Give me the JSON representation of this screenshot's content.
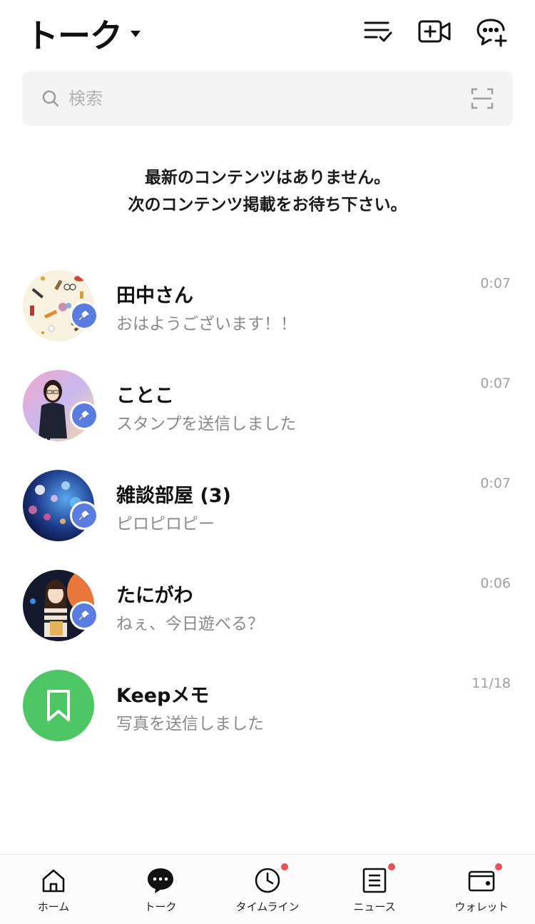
{
  "header": {
    "title": "トーク",
    "icons": [
      "edit-list-icon",
      "video-call-add-icon",
      "new-chat-icon"
    ]
  },
  "search": {
    "placeholder": "検索",
    "icons": [
      "search-icon",
      "qr-scan-icon"
    ]
  },
  "notice": {
    "line1": "最新のコンテンツはありません。",
    "line2": "次のコンテンツ掲載をお待ち下さい。"
  },
  "chats": [
    {
      "name": "田中さん",
      "message": "おはようございます！！",
      "time": "0:07",
      "pinned": true,
      "avatar": "tanaka-avatar"
    },
    {
      "name": "ことこ",
      "message": "スタンプを送信しました",
      "time": "0:07",
      "pinned": true,
      "avatar": "kotoko-avatar"
    },
    {
      "name": "雑談部屋 (3)",
      "message": "ピロピロピー",
      "time": "0:07",
      "pinned": true,
      "avatar": "group-avatar"
    },
    {
      "name": "たにがわ",
      "message": "ねぇ、今日遊べる？",
      "time": "0:06",
      "pinned": true,
      "avatar": "tanigawa-avatar"
    },
    {
      "name": "Keepメモ",
      "message": "写真を送信しました",
      "time": "11/18",
      "pinned": false,
      "avatar": "keep-bookmark-icon"
    }
  ],
  "tabs": [
    {
      "label": "ホーム",
      "icon": "home-icon",
      "badge": false
    },
    {
      "label": "トーク",
      "icon": "chat-icon",
      "badge": false,
      "active": true
    },
    {
      "label": "タイムライン",
      "icon": "clock-icon",
      "badge": true
    },
    {
      "label": "ニュース",
      "icon": "news-icon",
      "badge": true
    },
    {
      "label": "ウォレット",
      "icon": "wallet-icon",
      "badge": true
    }
  ],
  "colors": {
    "pin": "#5a7be0",
    "keep": "#4cc764",
    "badge": "#e8505a",
    "search_bg": "#f4f4f4"
  }
}
